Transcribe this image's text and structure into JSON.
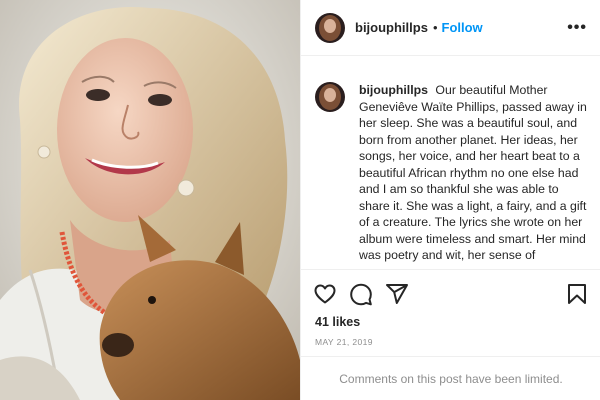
{
  "header": {
    "username": "bijouphillps",
    "separator": "•",
    "follow_label": "Follow",
    "more_label": "•••"
  },
  "caption": {
    "username": "bijouphillps",
    "text": "Our beautiful Mother Geneviêve Waïte Phillips, passed away in her sleep. She was a beautiful soul, and born from another planet. Her ideas, her songs, her voice, and her heart beat to a beautiful African rhythm no one else had and I am so thankful she was able to share it. She was a light, a fairy, and a gift of a creature. The lyrics she wrote on her album were timeless and smart. Her mind was poetry and wit, her sense of"
  },
  "actions": {
    "icons": [
      "heart-icon",
      "comment-icon",
      "share-icon",
      "bookmark-icon"
    ]
  },
  "likes_label": "41 likes",
  "date_label": "MAY 21, 2019",
  "comments_notice": "Comments on this post have been limited.",
  "colors": {
    "follow": "#0095f6",
    "muted": "#8e8e8e",
    "text": "#262626",
    "divider": "#efefef"
  }
}
